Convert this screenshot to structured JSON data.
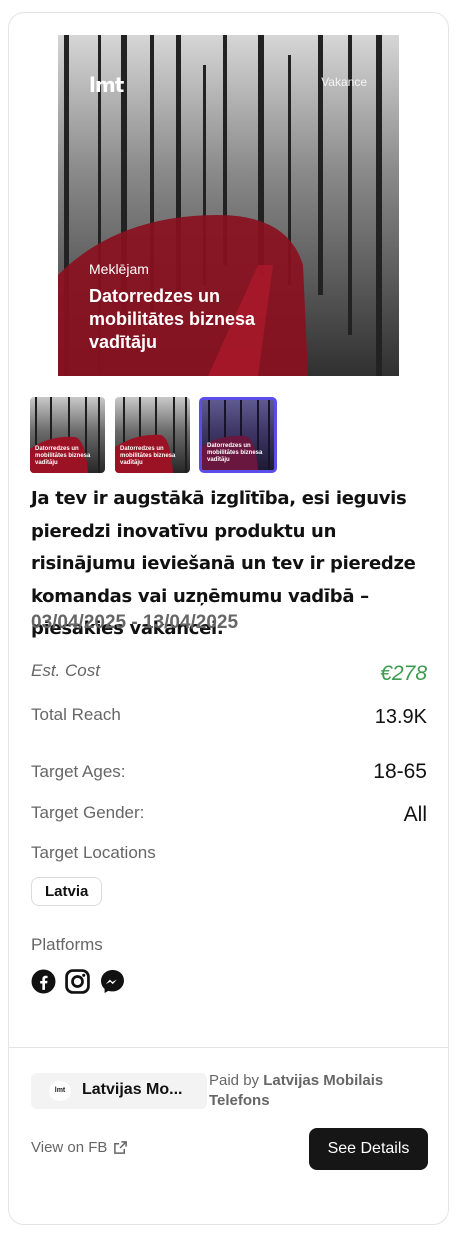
{
  "ad": {
    "hero": {
      "logo": "lmt",
      "tag": "Vakance",
      "subtitle": "Meklējam",
      "title": "Datorredzes un mobilitātes biznesa vadītāju"
    },
    "thumbnails": [
      {
        "caption": "Datorredzes un mobilitātes biznesa vadītāju",
        "selected": false
      },
      {
        "caption": "Datorredzes un mobilitātes biznesa vadītāju",
        "selected": false
      },
      {
        "caption": "Datorredzes un mobilitātes biznesa vadītāju",
        "selected": true
      }
    ],
    "description": "Ja tev ir augstākā izglītība, esi ieguvis pieredzi inovatīvu produktu un risinājumu ieviešanā un tev ir pieredze komandas vai uzņēmumu vadībā – piesakies vakancei.",
    "dates": "03/04/2025 - 13/04/2025"
  },
  "stats": {
    "cost_label": "Est. Cost",
    "cost_value": "€278",
    "reach_label": "Total Reach",
    "reach_value": "13.9K",
    "ages_label": "Target Ages:",
    "ages_value": "18-65",
    "gender_label": "Target Gender:",
    "gender_value": "All",
    "locations_label": "Target Locations",
    "locations": [
      "Latvia"
    ],
    "platforms_label": "Platforms",
    "platforms": [
      "facebook-icon",
      "instagram-icon",
      "messenger-icon"
    ]
  },
  "footer": {
    "page_name": "Latvijas Mo...",
    "page_avatar": "lmt",
    "paid_prefix": "Paid by",
    "paid_by": "Latvijas Mobilais Telefons",
    "view_fb": "View on FB",
    "details_button": "See Details"
  },
  "colors": {
    "cost": "#3c9b4f",
    "selected_border": "#5b4dea",
    "button_bg": "#161616"
  }
}
